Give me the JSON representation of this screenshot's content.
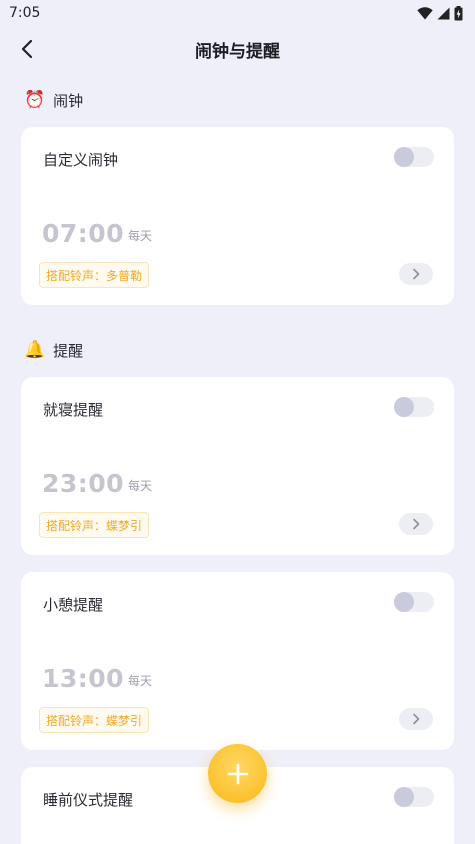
{
  "status_bar": {
    "time": "7:05"
  },
  "header": {
    "title": "闹钟与提醒"
  },
  "sections": [
    {
      "emoji": "⏰",
      "title": "闹钟"
    },
    {
      "emoji": "🔔",
      "title": "提醒"
    }
  ],
  "cards": [
    {
      "name": "自定义闹钟",
      "time": "07:00",
      "repeat": "每天",
      "ringtone": "搭配铃声：多普勒",
      "enabled": false
    },
    {
      "name": "就寝提醒",
      "time": "23:00",
      "repeat": "每天",
      "ringtone": "搭配铃声：蝶梦引",
      "enabled": false
    },
    {
      "name": "小憩提醒",
      "time": "13:00",
      "repeat": "每天",
      "ringtone": "搭配铃声：蝶梦引",
      "enabled": false
    },
    {
      "name": "睡前仪式提醒",
      "enabled": false
    }
  ],
  "fab": {
    "icon": "plus-icon"
  },
  "colors": {
    "background": "#eeeff8",
    "accent": "#fbc22f",
    "ringtone_text": "#f3a92b"
  }
}
